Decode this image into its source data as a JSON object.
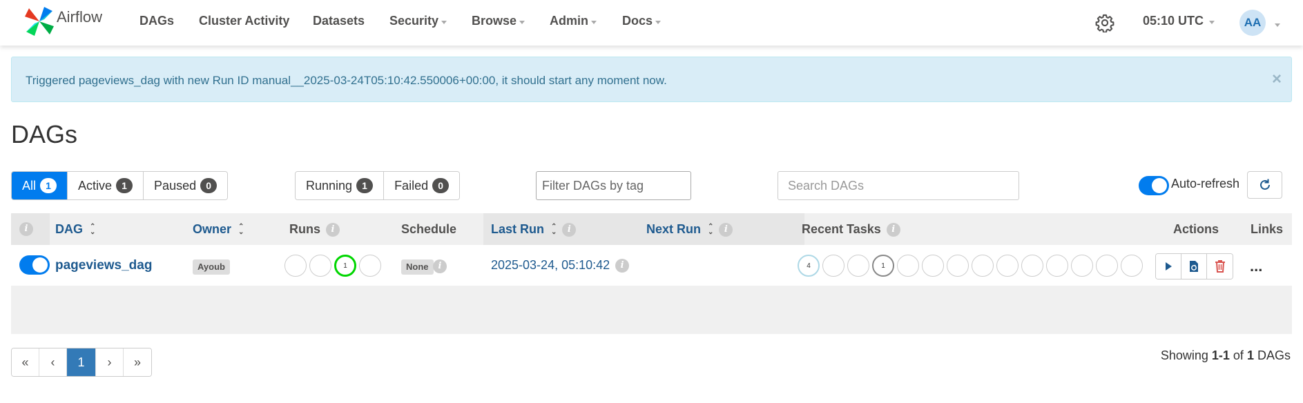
{
  "navbar": {
    "brand": "Airflow",
    "items": [
      {
        "label": "DAGs",
        "dropdown": false
      },
      {
        "label": "Cluster Activity",
        "dropdown": false
      },
      {
        "label": "Datasets",
        "dropdown": false
      },
      {
        "label": "Security",
        "dropdown": true
      },
      {
        "label": "Browse",
        "dropdown": true
      },
      {
        "label": "Admin",
        "dropdown": true
      },
      {
        "label": "Docs",
        "dropdown": true
      }
    ],
    "clock": "05:10 UTC",
    "avatar_initials": "AA"
  },
  "alert": {
    "message": "Triggered pageviews_dag with new Run ID manual__2025-03-24T05:10:42.550006+00:00, it should start any moment now.",
    "close": "×"
  },
  "page_title": "DAGs",
  "status_filters": [
    {
      "label": "All",
      "count": "1",
      "active": true
    },
    {
      "label": "Active",
      "count": "1",
      "active": false
    },
    {
      "label": "Paused",
      "count": "0",
      "active": false
    }
  ],
  "run_filters": [
    {
      "label": "Running",
      "count": "1"
    },
    {
      "label": "Failed",
      "count": "0"
    }
  ],
  "tag_filter": {
    "placeholder": "Filter DAGs by tag"
  },
  "search": {
    "placeholder": "Search DAGs"
  },
  "auto_refresh": {
    "label": "Auto-refresh",
    "enabled": true
  },
  "table": {
    "headers": {
      "dag": "DAG",
      "owner": "Owner",
      "runs": "Runs",
      "schedule": "Schedule",
      "last_run": "Last Run",
      "next_run": "Next Run",
      "recent_tasks": "Recent Tasks",
      "actions": "Actions",
      "links": "Links"
    },
    "rows": [
      {
        "paused": false,
        "dag_id": "pageviews_dag",
        "owner": "Ayoub",
        "runs": [
          "",
          "",
          "1",
          ""
        ],
        "schedule": "None",
        "last_run": "2025-03-24, 05:10:42",
        "next_run": "",
        "recent_tasks": [
          "4",
          "",
          "",
          "1",
          "",
          "",
          "",
          "",
          "",
          "",
          "",
          "",
          "",
          ""
        ],
        "more": "..."
      }
    ]
  },
  "pagination": {
    "first": "«",
    "prev": "‹",
    "current": "1",
    "next": "›",
    "last": "»"
  },
  "showing": {
    "prefix": "Showing",
    "range": "1-1",
    "of": "of",
    "total": "1",
    "suffix": "DAGs"
  },
  "colors": {
    "primary": "#017cee",
    "link": "#1e5a8f",
    "alert_bg": "#d9edf7",
    "running": "#00d600",
    "queued": "#add8e6",
    "delete": "#d9534f"
  },
  "icons": [
    "pinwheel-logo-icon",
    "gear-icon",
    "refresh-icon",
    "info-icon",
    "sort-icon",
    "play-icon",
    "refresh-dag-icon",
    "trash-icon",
    "ellipsis-icon"
  ]
}
